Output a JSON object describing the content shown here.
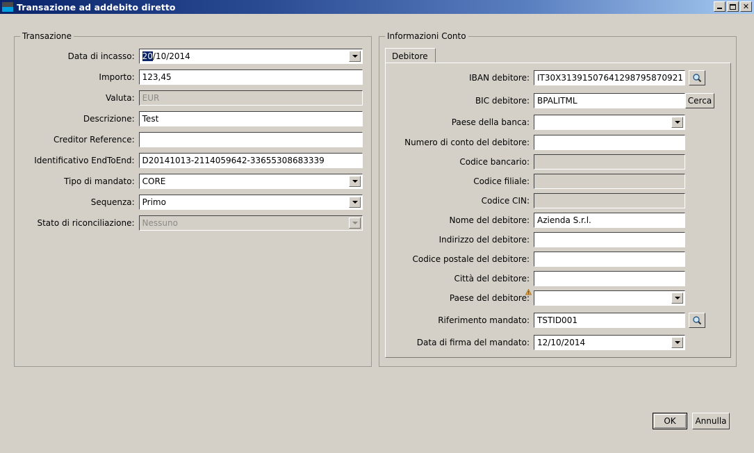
{
  "window": {
    "title": "Transazione ad addebito diretto",
    "icon": "app-icon",
    "controls": {
      "minimize": "minimize",
      "maximize": "maximize",
      "close": "close"
    }
  },
  "left_panel": {
    "legend": "Transazione",
    "fields": [
      {
        "label": "Data di incasso:",
        "type": "combo",
        "value_selected": "20",
        "value_rest": "/10/2014",
        "disabled": false
      },
      {
        "label": "Importo:",
        "type": "text",
        "value": "123,45",
        "disabled": false
      },
      {
        "label": "Valuta:",
        "type": "text",
        "value": "EUR",
        "disabled": true
      },
      {
        "label": "Descrizione:",
        "type": "text",
        "value": "Test",
        "disabled": false
      },
      {
        "label": "Creditor Reference:",
        "type": "text",
        "value": "",
        "disabled": false
      },
      {
        "label": "Identificativo EndToEnd:",
        "type": "text",
        "value": "D20141013-2114059642-33655308683339",
        "disabled": false
      },
      {
        "label": "Tipo di mandato:",
        "type": "combo",
        "value": "CORE",
        "disabled": false
      },
      {
        "label": "Sequenza:",
        "type": "combo",
        "value": "Primo",
        "disabled": false
      },
      {
        "label": "Stato di riconciliazione:",
        "type": "combo",
        "value": "Nessuno",
        "disabled": true
      }
    ]
  },
  "right_panel": {
    "legend": "Informazioni Conto",
    "tabs": [
      {
        "label": "Debitore",
        "active": true
      }
    ],
    "fields": [
      {
        "label": "IBAN debitore:",
        "type": "text",
        "value": "IT30X31391507641298795870921",
        "disabled": false,
        "button": "search-icon"
      },
      {
        "label": "BIC debitore:",
        "type": "text",
        "value": "BPALITML",
        "disabled": false,
        "button": "Cerca"
      },
      {
        "label": "Paese della banca:",
        "type": "combo",
        "value": "",
        "disabled": false
      },
      {
        "label": "Numero di conto del debitore:",
        "type": "text",
        "value": "",
        "disabled": false
      },
      {
        "label": "Codice bancario:",
        "type": "text",
        "value": "",
        "disabled": true
      },
      {
        "label": "Codice filiale:",
        "type": "text",
        "value": "",
        "disabled": true
      },
      {
        "label": "Codice CIN:",
        "type": "text",
        "value": "",
        "disabled": true
      },
      {
        "label": "Nome del debitore:",
        "type": "text",
        "value": "Azienda S.r.l.",
        "disabled": false
      },
      {
        "label": "Indirizzo del debitore:",
        "type": "text",
        "value": "",
        "disabled": false
      },
      {
        "label": "Codice postale del debitore:",
        "type": "text",
        "value": "",
        "disabled": false
      },
      {
        "label": "Città del debitore:",
        "type": "text",
        "value": "",
        "disabled": false
      },
      {
        "label": "Paese del debitore:",
        "type": "combo",
        "value": "",
        "disabled": false,
        "warning": true
      },
      {
        "label": "Riferimento mandato:",
        "type": "text",
        "value": "TSTID001",
        "disabled": false,
        "button": "search-icon"
      },
      {
        "label": "Data di firma del mandato:",
        "type": "combo",
        "value": "12/10/2014",
        "disabled": false
      }
    ]
  },
  "footer": {
    "ok_label": "OK",
    "cancel_label": "Annulla"
  },
  "colors": {
    "window_background": "#d4d0c8",
    "titlebar_start": "#0a246a",
    "titlebar_end": "#a6caf0",
    "selection": "#0a246a",
    "field_background": "#ffffff",
    "disabled_text": "#8b8b84",
    "warning": "#e8a33d"
  }
}
